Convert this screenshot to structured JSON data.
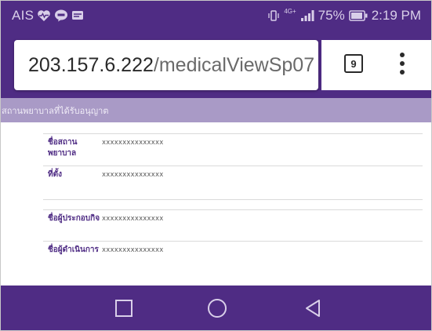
{
  "status_bar": {
    "carrier": "AIS",
    "network": "4G+",
    "battery_percent": "75%",
    "time": "2:19 PM",
    "icons": [
      "heart-pulse-icon",
      "line-app-icon",
      "message-icon",
      "gallery-icon",
      "vibrate-icon",
      "cellular-signal-icon",
      "battery-icon"
    ]
  },
  "browser": {
    "url_host": "203.157.6.222",
    "url_path": "/medicalViewSp07",
    "tab_count": "9"
  },
  "page": {
    "header": "สถานพยาบาลที่ได้รับอนุญาต",
    "table1": [
      {
        "label": "ชื่อสถานพยาบาล",
        "value": "xxxxxxxxxxxxxxx"
      },
      {
        "label": "ที่ตั้ง",
        "value": "xxxxxxxxxxxxxxx"
      }
    ],
    "table2": [
      {
        "label": "ชื่อผู้ประกอบกิจ",
        "value": "xxxxxxxxxxxxxxx"
      },
      {
        "label": "ชื่อผู้ดำเนินการ",
        "value": "xxxxxxxxxxxxxxx"
      }
    ]
  },
  "nav": {
    "buttons": [
      "recents-square-icon",
      "home-circle-icon",
      "back-triangle-icon"
    ]
  },
  "colors": {
    "brand_purple": "#4f2c84",
    "header_lavender": "#a99ac6",
    "label_purple": "#4f2c84"
  }
}
